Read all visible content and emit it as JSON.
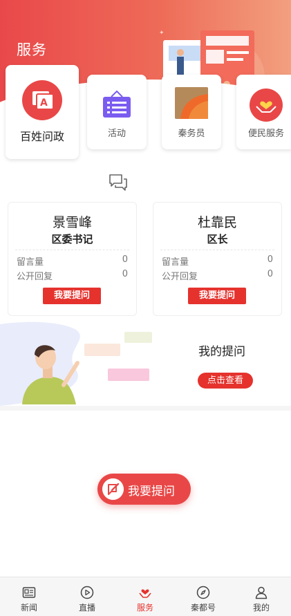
{
  "header": {
    "title": "服务"
  },
  "services": [
    {
      "label": "百姓问政",
      "icon": "message-a-icon"
    },
    {
      "label": "活动",
      "icon": "activity-board-icon"
    },
    {
      "label": "秦务员",
      "icon": "clerk-icon"
    },
    {
      "label": "便民服务",
      "icon": "heart-hands-icon"
    }
  ],
  "leaders": [
    {
      "name": "景雪峰",
      "title": "区委书记",
      "stats": [
        {
          "label": "留言量",
          "value": "0"
        },
        {
          "label": "公开回复",
          "value": "0"
        }
      ],
      "ask": "我要提问"
    },
    {
      "name": "杜靠民",
      "title": "区长",
      "stats": [
        {
          "label": "留言量",
          "value": "0"
        },
        {
          "label": "公开回复",
          "value": "0"
        }
      ],
      "ask": "我要提问"
    }
  ],
  "my_questions": {
    "title": "我的提问",
    "button": "点击查看"
  },
  "fab": {
    "label": "我要提问"
  },
  "tabs": [
    {
      "label": "新闻",
      "icon": "news-icon"
    },
    {
      "label": "直播",
      "icon": "play-icon"
    },
    {
      "label": "服务",
      "icon": "service-heart-icon",
      "active": true
    },
    {
      "label": "秦都号",
      "icon": "compass-icon"
    },
    {
      "label": "我的",
      "icon": "user-icon"
    }
  ],
  "colors": {
    "accent": "#e5322d",
    "header_start": "#e9484a",
    "header_end": "#f2a07f"
  }
}
